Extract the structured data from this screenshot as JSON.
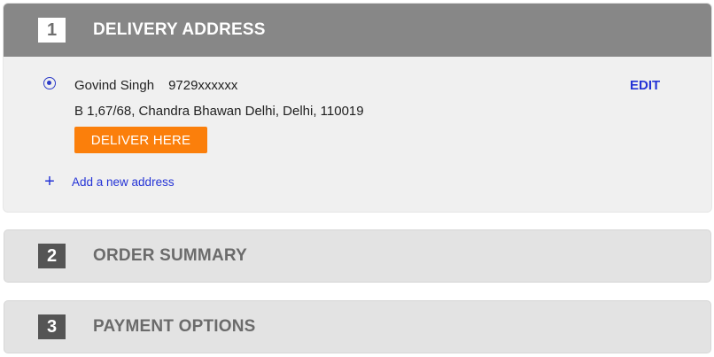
{
  "steps": [
    {
      "number": "1",
      "title": "DELIVERY ADDRESS"
    },
    {
      "number": "2",
      "title": "ORDER SUMMARY"
    },
    {
      "number": "3",
      "title": "PAYMENT OPTIONS"
    }
  ],
  "address": {
    "name": "Govind Singh",
    "phone": "9729xxxxxx",
    "full_address": "B 1,67/68, Chandra Bhawan Delhi, Delhi, 110019",
    "edit_label": "EDIT",
    "deliver_label": "DELIVER HERE",
    "selected": true
  },
  "add_address": {
    "icon": "plus-icon",
    "label": "Add a new address"
  },
  "colors": {
    "active_header": "#878787",
    "accent_blue": "#2433d6",
    "deliver_button": "#fb7f0b"
  }
}
